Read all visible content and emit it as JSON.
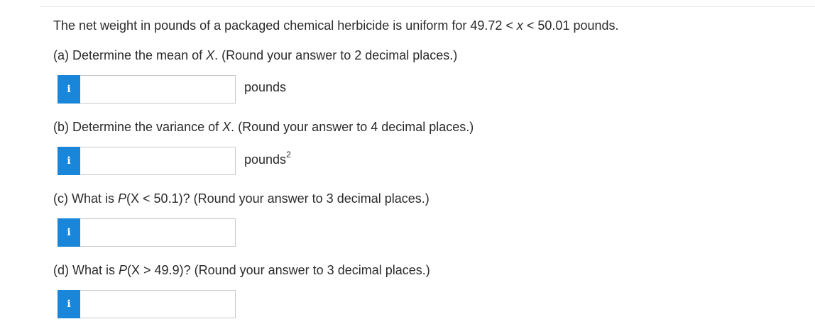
{
  "problem": {
    "intro_before_ineq": "The net weight in pounds of a packaged chemical herbicide is uniform for 49.72 < ",
    "intro_var": "x",
    "intro_after_ineq": " < 50.01 pounds."
  },
  "parts": [
    {
      "prefix": "(a) Determine the mean of ",
      "var": "X",
      "suffix": ". (Round your answer to 2 decimal places.)",
      "info_label": "i",
      "input_value": "",
      "unit": "pounds",
      "unit_sup": ""
    },
    {
      "prefix": "(b) Determine the variance of ",
      "var": "X",
      "suffix": ". (Round your answer to 4 decimal places.)",
      "info_label": "i",
      "input_value": "",
      "unit": "pounds",
      "unit_sup": "2"
    },
    {
      "prefix": "(c) What is ",
      "var": "P",
      "suffix": "(X < 50.1)? (Round your answer to 3 decimal places.)",
      "info_label": "i",
      "input_value": "",
      "unit": "",
      "unit_sup": ""
    },
    {
      "prefix": "(d) What is ",
      "var": "P",
      "suffix": "(X > 49.9)? (Round your answer to 3 decimal places.)",
      "info_label": "i",
      "input_value": "",
      "unit": "",
      "unit_sup": ""
    }
  ],
  "colors": {
    "info_button": "#1a86d9",
    "input_border": "#c9c9c9",
    "text": "#2b2b2b"
  },
  "icons": {
    "info": "info-icon"
  }
}
